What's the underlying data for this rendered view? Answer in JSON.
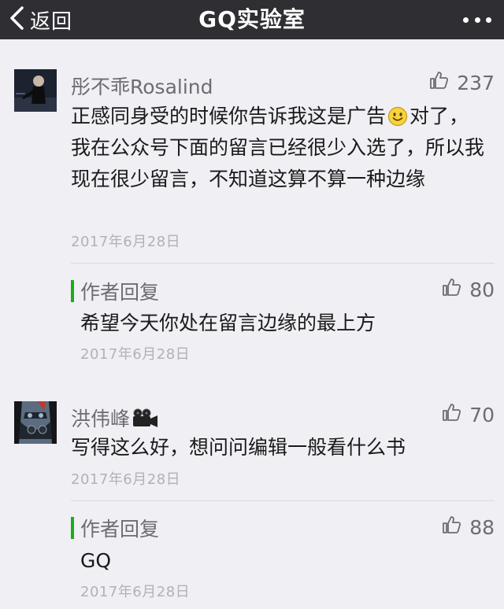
{
  "nav": {
    "back_label": "返回",
    "title": "GQ实验室"
  },
  "comments": [
    {
      "name": "彤不乖Rosalind",
      "likes": "237",
      "text_part1": "正感同身受的时候你告诉我这是广告",
      "emoji": "smile-emoji",
      "text_part2": "对了，我在公众号下面的留言已经很少入选了，所以我现在很少留言，不知道这算不算一种边缘",
      "date": "2017年6月28日",
      "reply": {
        "label": "作者回复",
        "likes": "80",
        "text": "希望今天你处在留言边缘的最上方",
        "date": "2017年6月28日"
      }
    },
    {
      "name": "洪伟峰",
      "name_icon": "movie-camera-emoji",
      "likes": "70",
      "text": "写得这么好，想问问编辑一般看什么书",
      "date": "2017年6月28日",
      "reply": {
        "label": "作者回复",
        "likes": "88",
        "text": "GQ",
        "date": "2017年6月28日"
      }
    }
  ],
  "colors": {
    "nav_bg": "#2e2e33",
    "page_bg": "#efeff4",
    "reply_bar": "#1aad19",
    "meta_text": "#6c6c72",
    "date_text": "#b2b2b6"
  },
  "icons": [
    "chevron-left-icon",
    "more-icon",
    "thumb-up-icon",
    "smile-emoji",
    "movie-camera-emoji"
  ]
}
